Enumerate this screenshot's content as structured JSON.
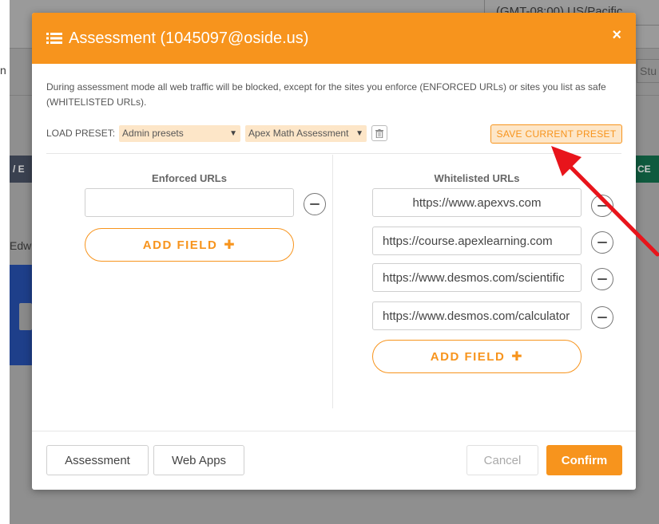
{
  "background": {
    "timezone": "(GMT-08:00) US/Pacific",
    "row_label": "n",
    "stu_label": "Stu",
    "left_button": "/ E",
    "right_button": "CE",
    "name_fragment": "Edwi"
  },
  "modal": {
    "title": "Assessment (1045097@oside.us)",
    "close_label": "×",
    "description": "During assessment mode all web traffic will be blocked, except for the sites you enforce (ENFORCED URLs) or sites you list as safe (WHITELISTED URLs).",
    "preset": {
      "label": "LOAD PRESET:",
      "preset_group": "Admin presets",
      "preset_name": "Apex Math Assessment",
      "save_label": "SAVE CURRENT PRESET"
    },
    "enforced": {
      "title": "Enforced URLs",
      "urls": [
        ""
      ],
      "add_label": "ADD FIELD"
    },
    "whitelisted": {
      "title": "Whitelisted URLs",
      "urls": [
        "https://www.apexvs.com",
        "https://course.apexlearning.com",
        "https://www.desmos.com/scientific",
        "https://www.desmos.com/calculator"
      ],
      "add_label": "ADD FIELD"
    },
    "footer": {
      "assessment_label": "Assessment",
      "webapps_label": "Web Apps",
      "cancel_label": "Cancel",
      "confirm_label": "Confirm"
    }
  },
  "colors": {
    "accent": "#f7941d",
    "accent_light": "#fde6c8",
    "annotation_arrow": "#e8141b"
  }
}
